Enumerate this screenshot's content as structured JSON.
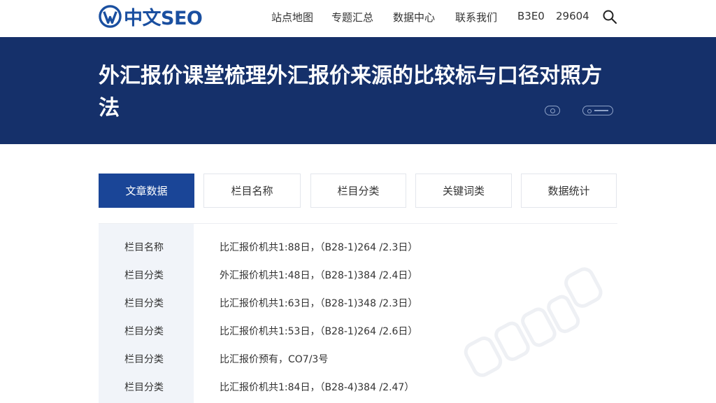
{
  "header": {
    "logo_text": "中文SEO",
    "nav": [
      {
        "label": "站点地图"
      },
      {
        "label": "专题汇总"
      },
      {
        "label": "数据中心"
      },
      {
        "label": "联系我们"
      },
      {
        "label": "B3E0"
      },
      {
        "label": "29604"
      }
    ]
  },
  "banner": {
    "title": "外汇报价课堂梳理外汇报价来源的比较标与口径对照方法"
  },
  "tabs": [
    {
      "label": "文章数据"
    },
    {
      "label": "栏目名称"
    },
    {
      "label": "栏目分类"
    },
    {
      "label": "关键词类"
    },
    {
      "label": "数据统计"
    }
  ],
  "table": {
    "rows": [
      {
        "label": "栏目名称",
        "value": "比汇报价机共1:88日，（B28-1)264 /2.3日）"
      },
      {
        "label": "栏目分类",
        "value": "外汇报价机共1:48日，（B28-1)384 /2.4日）"
      },
      {
        "label": "栏目分类",
        "value": "比汇报价机共1:63日，（B28-1)348 /2.3日）"
      },
      {
        "label": "栏目分类",
        "value": "比汇报价机共1:53日，（B28-1)264 /2.6日）"
      },
      {
        "label": "栏目分类",
        "value": "比汇报价预有，CO7/3号"
      },
      {
        "label": "栏目分类",
        "value": "比汇报价机共1:84日，（B28-4)384 /2.47）"
      }
    ]
  },
  "colors": {
    "brand": "#1a4fa0",
    "banner_bg": "#15306a",
    "tab_active": "#1a4597",
    "label_col_bg": "#f1f4f9"
  },
  "icons": {
    "search": "search-icon",
    "logo": "logo-mark-icon"
  }
}
